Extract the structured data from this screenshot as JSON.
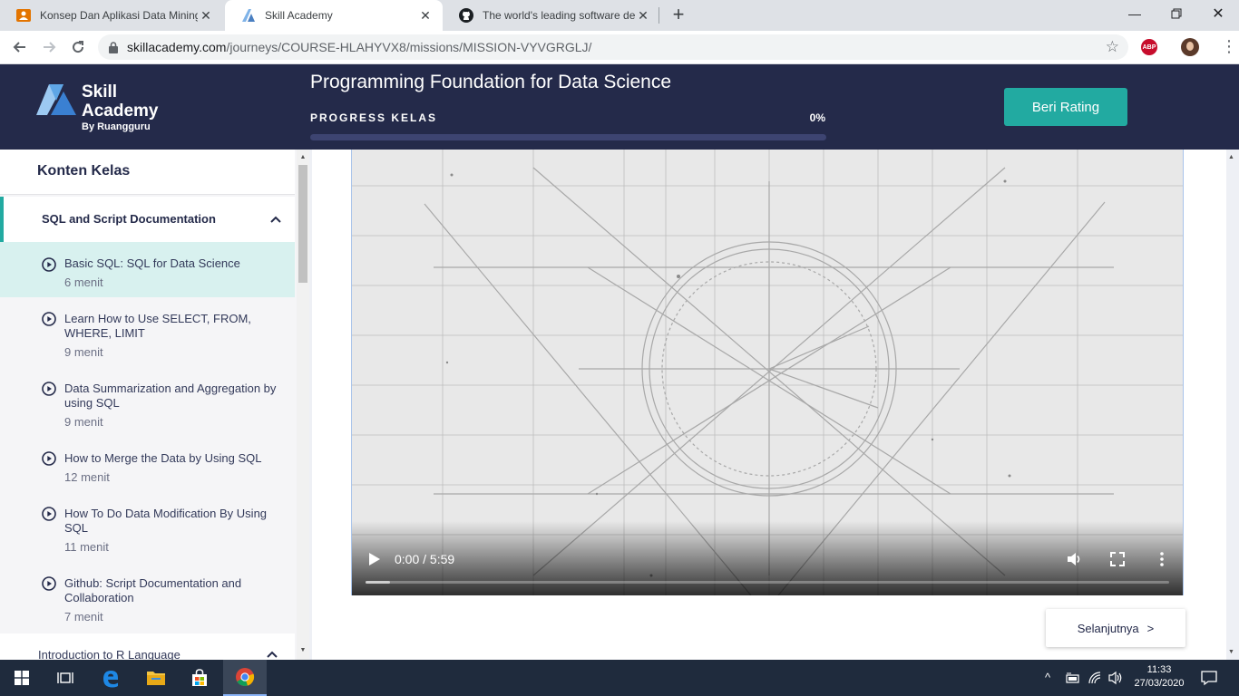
{
  "browser": {
    "tabs": [
      {
        "title": "Konsep Dan Aplikasi Data Mining",
        "active": false
      },
      {
        "title": "Skill Academy",
        "active": true
      },
      {
        "title": "The world's leading software dev",
        "active": false
      }
    ],
    "url_host": "skillacademy.com",
    "url_path": "/journeys/COURSE-HLAHYVX8/missions/MISSION-VYVGRGLJ/",
    "abp_label": "ABP"
  },
  "header": {
    "logo_line1": "Skill",
    "logo_line2": "Academy",
    "logo_line3": "By Ruangguru",
    "course_title": "Programming Foundation for Data Science",
    "progress_label": "PROGRESS KELAS",
    "progress_text": "0%",
    "progress_fraction": 0,
    "rating_button": "Beri Rating"
  },
  "sidebar": {
    "heading": "Konten Kelas",
    "section_title": "SQL and Script Documentation",
    "lessons": [
      {
        "title": "Basic SQL: SQL for Data Science",
        "duration": "6 menit",
        "active": true
      },
      {
        "title": "Learn How to Use SELECT, FROM, WHERE, LIMIT",
        "duration": "9 menit",
        "active": false
      },
      {
        "title": "Data Summarization and Aggregation by using SQL",
        "duration": "9 menit",
        "active": false
      },
      {
        "title": "How to Merge the Data by Using SQL",
        "duration": "12 menit",
        "active": false
      },
      {
        "title": "How To Do Data Modification By Using SQL",
        "duration": "11 menit",
        "active": false
      },
      {
        "title": "Github: Script Documentation and Collaboration",
        "duration": "7 menit",
        "active": false
      }
    ],
    "next_section_title": "Introduction to R Language"
  },
  "video": {
    "time": "0:00 / 5:59",
    "progress_fraction": 0,
    "buffered_fraction": 0.03
  },
  "next_button": {
    "label": "Selanjutnya",
    "arrow": ">"
  },
  "taskbar": {
    "time": "11:33",
    "date": "27/03/2020"
  },
  "colors": {
    "header_bg": "#242a4a",
    "accent": "#22aaa1",
    "active_lesson_bg": "#d8f1ef"
  }
}
